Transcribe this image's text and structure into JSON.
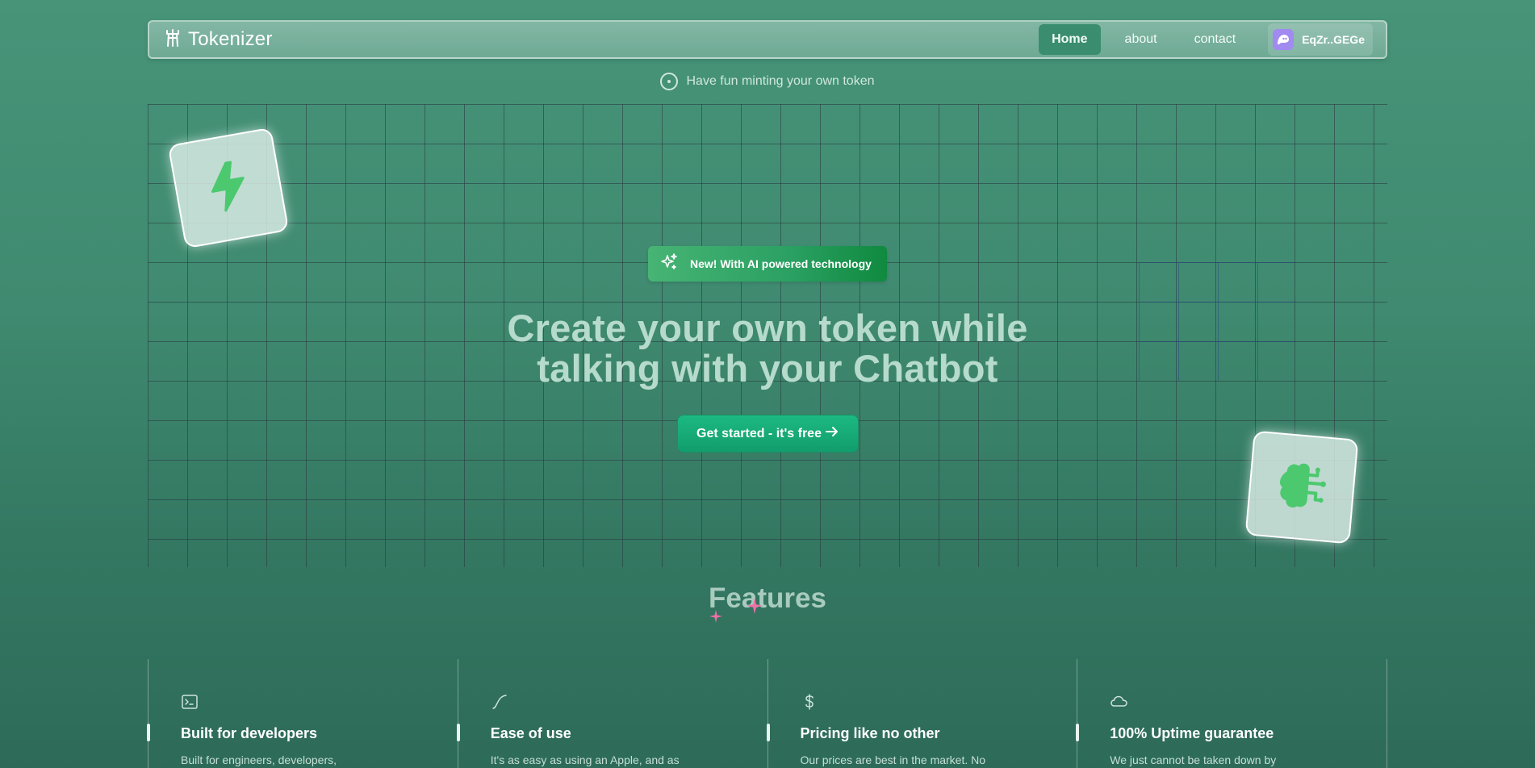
{
  "navbar": {
    "brand": "Tokenizer",
    "links": [
      {
        "label": "Home",
        "active": true
      },
      {
        "label": "about",
        "active": false
      },
      {
        "label": "contact",
        "active": false
      }
    ],
    "wallet_address": "EqZr..GEGe"
  },
  "tagline": "Have fun minting your own token",
  "hero": {
    "badge": "New! With AI powered technology",
    "title_line1": "Create your own token while",
    "title_line2": "talking with your Chatbot",
    "cta": "Get started - it's free"
  },
  "features": {
    "title": "Features",
    "items": [
      {
        "icon": "terminal-icon",
        "title": "Built for developers",
        "desc": "Built for engineers, developers,"
      },
      {
        "icon": "curve-icon",
        "title": "Ease of use",
        "desc": "It's as easy as using an Apple, and as"
      },
      {
        "icon": "dollar-icon",
        "title": "Pricing like no other",
        "desc": "Our prices are best in the market. No"
      },
      {
        "icon": "cloud-icon",
        "title": "100% Uptime guarantee",
        "desc": "We just cannot be taken down by"
      }
    ]
  },
  "colors": {
    "accent": "#1cb982",
    "badge": "#2aa062",
    "wallet_avatar": "#a18af0",
    "icon_green": "#4cc96e",
    "sparkle_pink": "#f06fa7"
  }
}
